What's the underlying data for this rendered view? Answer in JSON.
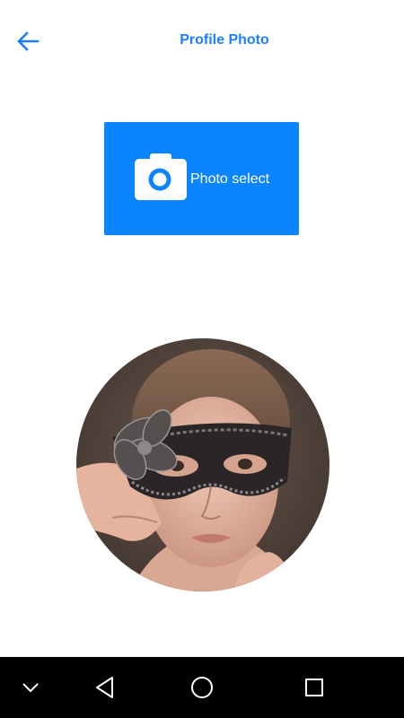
{
  "header": {
    "title": "Profile Photo",
    "back_icon": "arrow-left-icon"
  },
  "photo_select": {
    "label": "Photo select",
    "icon": "camera-icon",
    "color": "#0a84ff"
  },
  "avatar": {
    "icon": "profile-photo"
  },
  "navbar": {
    "items": [
      "chevron-down-icon",
      "back-triangle-icon",
      "home-circle-icon",
      "recents-square-icon"
    ]
  },
  "colors": {
    "accent": "#1a80ff",
    "button": "#0a84ff",
    "navbar": "#000000"
  }
}
